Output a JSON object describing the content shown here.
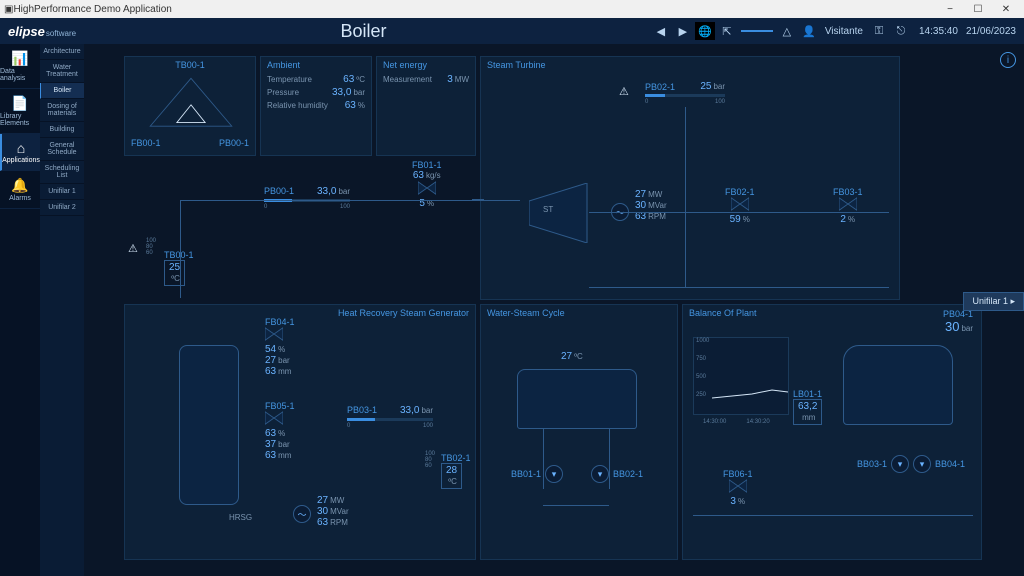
{
  "window": {
    "title": "HighPerformance Demo Application"
  },
  "header": {
    "brand": "elipse",
    "brand_sub": "software",
    "page_title": "Boiler",
    "user_label": "Visitante",
    "time": "14:35:40",
    "date": "21/06/2023"
  },
  "nav": {
    "items": [
      {
        "label": "Data analysis",
        "icon": "chart-icon"
      },
      {
        "label": "Library Elements",
        "icon": "library-icon"
      },
      {
        "label": "Applications",
        "icon": "home-icon",
        "selected": true
      },
      {
        "label": "Alarms",
        "icon": "bell-icon"
      }
    ],
    "sub": [
      {
        "label": "Architecture"
      },
      {
        "label": "Water Treatment"
      },
      {
        "label": "Boiler",
        "selected": true
      },
      {
        "label": "Dosing of materials"
      },
      {
        "label": "Building"
      },
      {
        "label": "General Schedule"
      },
      {
        "label": "Scheduling List"
      },
      {
        "label": "Unifilar 1"
      },
      {
        "label": "Unifilar 2"
      }
    ]
  },
  "ambient": {
    "title": "Ambient",
    "temp_label": "Temperature",
    "temp_val": "63",
    "temp_unit": "ºC",
    "press_label": "Pressure",
    "press_val": "33,0",
    "press_unit": "bar",
    "rh_label": "Relative humidity",
    "rh_val": "63",
    "rh_unit": "%"
  },
  "net_energy": {
    "title": "Net energy",
    "meas_label": "Measurement",
    "meas_val": "3",
    "meas_unit": "MW"
  },
  "tb00": {
    "title": "TB00-1",
    "left": "FB00-1",
    "right": "PB00-1"
  },
  "steam_turbine": {
    "title": "Steam Turbine",
    "pb02": {
      "name": "PB02-1",
      "val": "25",
      "unit": "bar",
      "min": "0",
      "max": "100"
    },
    "st_label": "ST",
    "gen": {
      "mw": "27",
      "mw_u": "MW",
      "mvar": "30",
      "mvar_u": "MVar",
      "rpm": "63",
      "rpm_u": "RPM"
    },
    "fb02": {
      "name": "FB02-1",
      "val": "59",
      "unit": "%"
    },
    "fb03": {
      "name": "FB03-1",
      "val": "2",
      "unit": "%"
    }
  },
  "center": {
    "pb00": {
      "name": "PB00-1",
      "val": "33,0",
      "unit": "bar",
      "min": "0",
      "max": "100"
    },
    "fb01": {
      "name": "FB01-1",
      "flow": "63",
      "flow_unit": "kg/s",
      "open": "5",
      "open_unit": "%"
    },
    "tb00_sensor": {
      "name": "TB00-1",
      "val": "25",
      "unit": "ºC",
      "ticks": [
        "100",
        "80",
        "60"
      ]
    }
  },
  "hrsg": {
    "title": "Heat Recovery Steam Generator",
    "block": "HRSG",
    "fb04": {
      "name": "FB04-1",
      "open": "54",
      "open_unit": "%",
      "press": "27",
      "press_unit": "bar",
      "len": "63",
      "len_unit": "mm"
    },
    "fb05": {
      "name": "FB05-1",
      "open": "63",
      "open_unit": "%",
      "press": "37",
      "press_unit": "bar",
      "len": "63",
      "len_unit": "mm"
    },
    "pb03": {
      "name": "PB03-1",
      "val": "33,0",
      "unit": "bar",
      "min": "0",
      "max": "100"
    },
    "tb02": {
      "name": "TB02-1",
      "val": "28",
      "unit": "ºC",
      "ticks": [
        "100",
        "80",
        "60"
      ]
    },
    "gen": {
      "mw": "27",
      "mw_u": "MW",
      "mvar": "30",
      "mvar_u": "MVar",
      "rpm": "63",
      "rpm_u": "RPM"
    }
  },
  "wsc": {
    "title": "Water-Steam Cycle",
    "temp": "27",
    "temp_unit": "ºC",
    "bb01": "BB01-1",
    "bb02": "BB02-1"
  },
  "bop": {
    "title": "Balance Of Plant",
    "pb04": {
      "name": "PB04-1",
      "val": "30",
      "unit": "bar"
    },
    "lb01": {
      "name": "LB01-1",
      "val": "63,2",
      "unit": "mm"
    },
    "chart": {
      "ymax": "1000",
      "y750": "750",
      "y500": "500",
      "y250": "250",
      "x1": "14:30:00",
      "x2": "14:30:20"
    },
    "fb06": {
      "name": "FB06-1",
      "val": "3",
      "unit": "%"
    },
    "bb03": "BB03-1",
    "bb04": "BB04-1"
  },
  "side_tab": "Unifilar 1"
}
